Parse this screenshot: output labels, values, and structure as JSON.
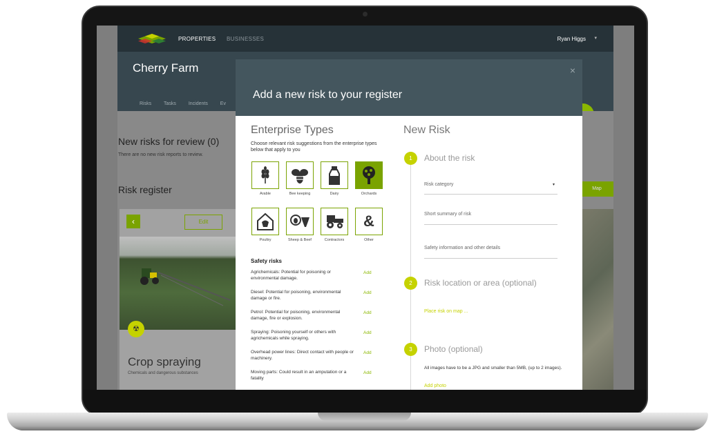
{
  "nav": {
    "properties": "PROPERTIES",
    "businesses": "BUSINESSES",
    "user": "Ryan Higgs",
    "user_caret": "▾"
  },
  "header": {
    "farm_name": "Cherry Farm",
    "tabs": [
      "Risks",
      "Tasks",
      "Incidents",
      "Ev"
    ]
  },
  "page": {
    "new_risks_title": "New risks for review (0)",
    "new_risks_sub": "There are no new risk reports to review.",
    "risk_register_title": "Risk register",
    "map_button": "Map"
  },
  "card": {
    "back_glyph": "‹",
    "edit_label": "Edit",
    "title": "Crop spraying",
    "subtitle": "Chemicals and dangerous substances"
  },
  "modal": {
    "title": "Add a new risk to your register",
    "close_glyph": "×",
    "enterprise": {
      "title": "Enterprise Types",
      "description": "Choose relevant risk suggestions from the enterprise types below that apply to you",
      "types": [
        {
          "label": "Arable",
          "icon": "wheat-icon",
          "selected": false
        },
        {
          "label": "Bee keeping",
          "icon": "bee-icon",
          "selected": false
        },
        {
          "label": "Dairy",
          "icon": "milk-bottle-icon",
          "selected": false
        },
        {
          "label": "Orchards",
          "icon": "tree-icon",
          "selected": true
        },
        {
          "label": "Poultry",
          "icon": "chicken-house-icon",
          "selected": false
        },
        {
          "label": "Sheep & Beef",
          "icon": "sheep-cow-icon",
          "selected": false
        },
        {
          "label": "Contractors",
          "icon": "tractor-icon",
          "selected": false
        },
        {
          "label": "Other",
          "icon": "ampersand-icon",
          "selected": false
        }
      ]
    },
    "safety": {
      "title": "Safety risks",
      "add_label": "Add",
      "risks": [
        "Agrichemicals: Potential for poisoning or environmental damage.",
        "Diesel: Potential for poisoning, environmental damage or fire.",
        "Petrol: Potential for poisoning, environmental damage, fire or explosion.",
        "Spraying: Poisoning yourself or others with agrichemicals while spraying.",
        "Overhead power lines: Direct contact with people or machinery.",
        "Moving parts: Could result in an amputation or a fatality"
      ]
    },
    "new_risk": {
      "title": "New Risk",
      "step1": {
        "num": "1",
        "title": "About the risk"
      },
      "category_placeholder": "Risk category",
      "category_caret": "▾",
      "summary_placeholder": "Short summary of risk",
      "details_placeholder": "Safety information and other details",
      "step2": {
        "num": "2",
        "title": "Risk location or area (optional)"
      },
      "place_on_map": "Place risk on map ...",
      "step3": {
        "num": "3",
        "title": "Photo (optional)"
      },
      "photo_info": "All images have to be a JPG and smaller than 5MB, (up to 2 images).",
      "add_photo": "Add photo"
    }
  },
  "colors": {
    "nav_bg": "#263238",
    "header_bg": "#37474f",
    "modal_head": "#44565e",
    "accent_green": "#7aa300",
    "accent_lime": "#c5d200"
  }
}
